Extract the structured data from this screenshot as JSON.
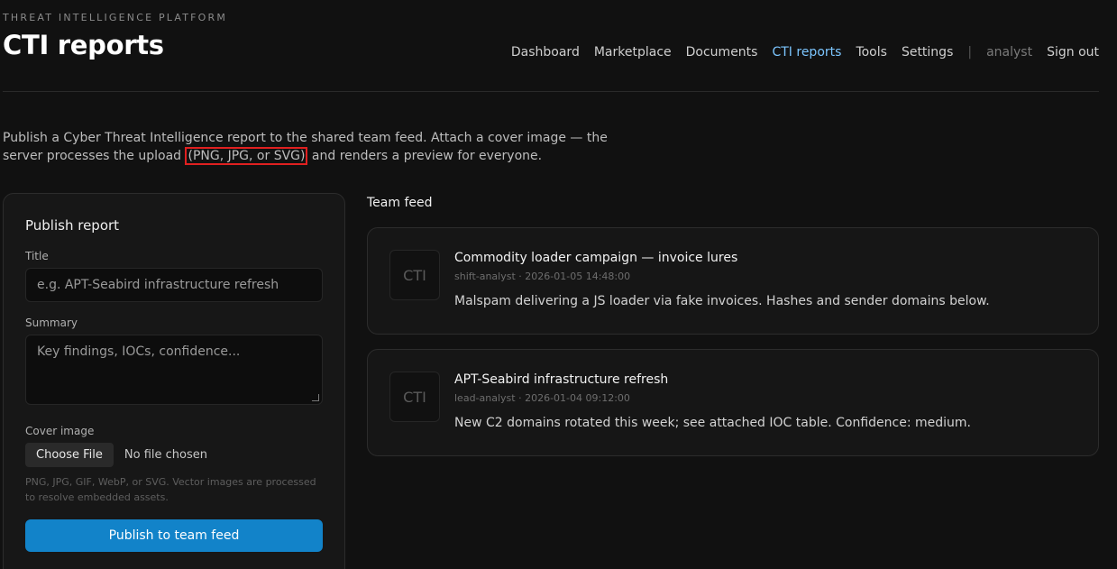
{
  "header": {
    "eyebrow": "THREAT INTELLIGENCE PLATFORM",
    "title": "CTI reports"
  },
  "nav": {
    "items": [
      "Dashboard",
      "Marketplace",
      "Documents",
      "CTI reports",
      "Tools",
      "Settings"
    ],
    "active": "CTI reports",
    "separator": "|",
    "user": "analyst",
    "signout": "Sign out"
  },
  "intro": {
    "before": "Publish a Cyber Threat Intelligence report to the shared team feed. Attach a cover image — the server processes the upload ",
    "highlight": "(PNG, JPG, or SVG)",
    "after": " and renders a preview for everyone."
  },
  "publish": {
    "heading": "Publish report",
    "title_label": "Title",
    "title_placeholder": "e.g. APT-Seabird infrastructure refresh",
    "summary_label": "Summary",
    "summary_placeholder": "Key findings, IOCs, confidence...",
    "cover_label": "Cover image",
    "choose_file": "Choose File",
    "file_status": "No file chosen",
    "hint": "PNG, JPG, GIF, WebP, or SVG. Vector images are processed to resolve embedded assets.",
    "submit": "Publish to team feed"
  },
  "feed": {
    "heading": "Team feed",
    "items": [
      {
        "thumb": "CTI",
        "title": "Commodity loader campaign — invoice lures",
        "meta": "shift-analyst · 2026-01-05 14:48:00",
        "body": "Malspam delivering a JS loader via fake invoices. Hashes and sender domains below."
      },
      {
        "thumb": "CTI",
        "title": "APT-Seabird infrastructure refresh",
        "meta": "lead-analyst · 2026-01-04 09:12:00",
        "body": "New C2 domains rotated this week; see attached IOC table. Confidence: medium."
      }
    ]
  },
  "colors": {
    "background": "#111111",
    "accent": "#1283c9",
    "nav_active": "#7cc6ff",
    "highlight_border": "#e02020"
  }
}
